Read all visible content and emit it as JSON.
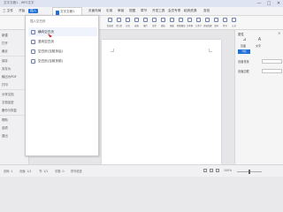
{
  "titlebar": {
    "doc_title": "文字文稿1 - WPS文字",
    "minimize": "—",
    "maximize": "□",
    "close": "✕"
  },
  "menubar": {
    "items": [
      "三 文件",
      "开始",
      "插入",
      "页面布局",
      "引用",
      "审阅",
      "视图",
      "章节",
      "开发工具",
      "会员专享",
      "稻壳资源"
    ],
    "active_index": 2,
    "doc_tab_label": "文字文稿1",
    "search_label": "查找"
  },
  "ribbon": {
    "buttons": [
      "封面页",
      "空白页",
      "分页",
      "表格",
      "图片",
      "形状",
      "图标",
      "图表",
      "智能图形",
      "文本框",
      "艺术字",
      "页眉页脚",
      "页码",
      "符号",
      "公式"
    ]
  },
  "leftnav": {
    "items": [
      "新建",
      "打开",
      "最近",
      "保存",
      "另存为",
      "输出为PDF",
      "打印",
      "分享文档",
      "文档加密",
      "备份与恢复",
      "帮助",
      "选项",
      "退出"
    ]
  },
  "dropdown": {
    "header": "插入空白页",
    "items": [
      {
        "label": "横向空白页",
        "icon": "page-landscape-icon"
      },
      {
        "label": "竖向空白页",
        "icon": "page-portrait-icon"
      },
      {
        "label": "空白页(当前页后)",
        "icon": "page-blank-icon"
      },
      {
        "label": "空白页(当前页前)",
        "icon": "page-blank-before-icon"
      }
    ]
  },
  "taskpane": {
    "title": "属性",
    "close": "✕",
    "tab_labels": [
      "页面",
      "文字"
    ],
    "action_button": "分栏",
    "rows": [
      {
        "label": "页面背景"
      },
      {
        "label": "页面边框"
      }
    ]
  },
  "statusbar": {
    "page": "页码: 1",
    "pages": "页面: 1/1",
    "section": "节: 1/1",
    "words": "字数: 0",
    "spell": "拼写检查",
    "zoom": "100%"
  },
  "colors": {
    "accent": "#1f6fd8",
    "cursor": "#c62828"
  }
}
